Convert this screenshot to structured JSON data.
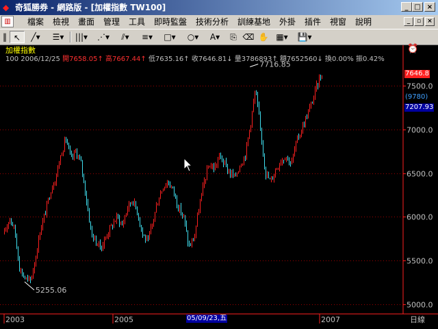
{
  "window": {
    "title": "奇狐勝券 - 網路版 - [加權指數 TW100]",
    "min_glyph": "_",
    "max_glyph": "□",
    "close_glyph": "×",
    "app_icon": "fox-logo-icon"
  },
  "menubar": {
    "doc_icon": "chart-document-icon",
    "items": [
      "檔案",
      "檢視",
      "畫面",
      "管理",
      "工具",
      "即時監盤",
      "技術分析",
      "訓練基地",
      "外掛",
      "插件",
      "視窗",
      "說明"
    ],
    "child_min": "_",
    "child_restore": "▫",
    "child_close": "×"
  },
  "toolbar": {
    "tools": [
      {
        "name": "grip-icon",
        "glyph": "‖"
      },
      {
        "name": "pointer-icon",
        "glyph": "↖"
      },
      {
        "name": "line-tool-icon",
        "glyph": "╱▾"
      },
      {
        "name": "horizontal-lines-icon",
        "glyph": "☰▾"
      },
      {
        "name": "vertical-lines-icon",
        "glyph": "|||▾"
      },
      {
        "name": "fan-lines-icon",
        "glyph": "⋰▾"
      },
      {
        "name": "channel-icon",
        "glyph": "⫽▾"
      },
      {
        "name": "parallel-lines-icon",
        "glyph": "≡▾"
      },
      {
        "name": "rectangle-icon",
        "glyph": "□▾"
      },
      {
        "name": "ellipse-icon",
        "glyph": "○▾"
      },
      {
        "name": "text-tool-icon",
        "glyph": "A▾"
      },
      {
        "name": "copy-icon",
        "glyph": "⎘"
      },
      {
        "name": "eraser-icon",
        "glyph": "⌫"
      },
      {
        "name": "hand-icon",
        "glyph": "✋"
      },
      {
        "name": "color-palette-icon",
        "glyph": "▦▾"
      },
      {
        "name": "save-icon",
        "glyph": "💾▾"
      }
    ]
  },
  "chart": {
    "name_label": "加權指數",
    "info_prefix": "100 2006/12/25",
    "open_label": "開7658.05↑",
    "high_label": "高7667.44↑",
    "low_label": "低7635.16↑",
    "close_label": "收7646.81↓",
    "volume_label": "量3786893↑",
    "amount_label": "額7652560↓",
    "turnover_label": "換0.00%",
    "amplitude_label": "振0.42%",
    "top_right_icon": "alarm-clock-icon",
    "last_price_tag": "7646.8",
    "count_tag": "(9780)",
    "cursor_price_tag": "7207.93",
    "cursor_date_tag": "05/09/23,五",
    "axis_label": "日線",
    "colors": {
      "up": "#ff2020",
      "down": "#40e0f0",
      "axis": "#ff2020",
      "grid": "#a00000",
      "text": "#c0c0c0",
      "name": "#ffff00"
    }
  },
  "chart_data": {
    "type": "candlestick",
    "y_ticks": [
      7500,
      7000,
      6500,
      6000,
      5500,
      5000
    ],
    "x_ticks": [
      "2003",
      "2005",
      "2007"
    ],
    "ylim": [
      4950,
      7760
    ],
    "annotations": [
      {
        "date": "2006/12",
        "value": 7716.85,
        "label": "7716.85"
      },
      {
        "date": "2003/04",
        "value": 5255.06,
        "label": "5255.06"
      }
    ],
    "trend": [
      {
        "date": "2002/12",
        "value": 5800
      },
      {
        "date": "2003/01",
        "value": 6000
      },
      {
        "date": "2003/02",
        "value": 5850
      },
      {
        "date": "2003/03",
        "value": 5400
      },
      {
        "date": "2003/04",
        "value": 5300
      },
      {
        "date": "2003/05",
        "value": 5250
      },
      {
        "date": "2003/06",
        "value": 5500
      },
      {
        "date": "2003/07",
        "value": 5850
      },
      {
        "date": "2003/08",
        "value": 6050
      },
      {
        "date": "2003/09",
        "value": 6300
      },
      {
        "date": "2003/10",
        "value": 6450
      },
      {
        "date": "2003/11",
        "value": 6700
      },
      {
        "date": "2003/12",
        "value": 6900
      },
      {
        "date": "2004/01",
        "value": 6650
      },
      {
        "date": "2004/02",
        "value": 6750
      },
      {
        "date": "2004/03",
        "value": 6600
      },
      {
        "date": "2004/04",
        "value": 6200
      },
      {
        "date": "2004/05",
        "value": 5800
      },
      {
        "date": "2004/06",
        "value": 5700
      },
      {
        "date": "2004/07",
        "value": 5650
      },
      {
        "date": "2004/08",
        "value": 5800
      },
      {
        "date": "2004/09",
        "value": 5900
      },
      {
        "date": "2004/10",
        "value": 6000
      },
      {
        "date": "2004/11",
        "value": 5900
      },
      {
        "date": "2004/12",
        "value": 6100
      },
      {
        "date": "2005/01",
        "value": 6200
      },
      {
        "date": "2005/02",
        "value": 6050
      },
      {
        "date": "2005/03",
        "value": 5800
      },
      {
        "date": "2005/04",
        "value": 5700
      },
      {
        "date": "2005/05",
        "value": 5950
      },
      {
        "date": "2005/06",
        "value": 6200
      },
      {
        "date": "2005/07",
        "value": 6350
      },
      {
        "date": "2005/08",
        "value": 6400
      },
      {
        "date": "2005/09",
        "value": 6300
      },
      {
        "date": "2005/10",
        "value": 6100
      },
      {
        "date": "2005/11",
        "value": 6000
      },
      {
        "date": "2005/12",
        "value": 5650
      },
      {
        "date": "2006/01",
        "value": 5750
      },
      {
        "date": "2006/02",
        "value": 6100
      },
      {
        "date": "2006/03",
        "value": 6400
      },
      {
        "date": "2006/04",
        "value": 6600
      },
      {
        "date": "2006/05",
        "value": 6550
      },
      {
        "date": "2006/06",
        "value": 6700
      },
      {
        "date": "2006/07",
        "value": 6600
      },
      {
        "date": "2006/08",
        "value": 6500
      },
      {
        "date": "2006/09",
        "value": 6450
      },
      {
        "date": "2006/10",
        "value": 6600
      },
      {
        "date": "2006/11",
        "value": 6700
      },
      {
        "date": "2006/12",
        "value": 7050
      },
      {
        "date": "2007/01",
        "value": 7450
      },
      {
        "date": "2007/02",
        "value": 7000
      },
      {
        "date": "2007/03",
        "value": 6500
      },
      {
        "date": "2007/04",
        "value": 6400
      },
      {
        "date": "2007/05",
        "value": 6550
      },
      {
        "date": "2007/06",
        "value": 6650
      },
      {
        "date": "2007/07",
        "value": 6700
      },
      {
        "date": "2007/08",
        "value": 6600
      },
      {
        "date": "2007/09",
        "value": 6850
      },
      {
        "date": "2007/10",
        "value": 7000
      },
      {
        "date": "2007/11",
        "value": 7150
      },
      {
        "date": "2007/12",
        "value": 7300
      },
      {
        "date": "2008/01",
        "value": 7500
      },
      {
        "date": "2008/02",
        "value": 7650
      }
    ]
  }
}
